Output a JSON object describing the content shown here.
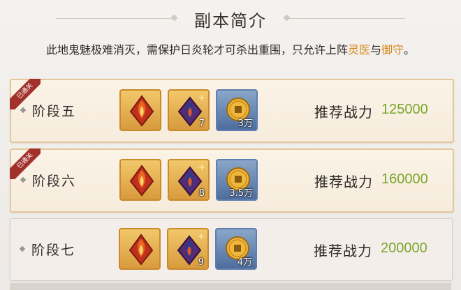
{
  "header": {
    "title": "副本简介",
    "description_prefix": "此地鬼魅极难消灭，需保护日炎轮才可杀出重围，只允许上阵",
    "highlight_1": "灵医",
    "connector": "与",
    "highlight_2": "御守",
    "description_suffix": "。"
  },
  "stages": [
    {
      "name": "阶段五",
      "cleared_label": "已通关",
      "rewards": [
        {
          "icon": "red-fire-fragment-icon",
          "qty": ""
        },
        {
          "icon": "purple-fire-fragment-icon",
          "qty": "7"
        },
        {
          "icon": "gold-coin-icon",
          "qty": "3万"
        }
      ],
      "power_label": "推荐战力",
      "power_value": "125000"
    },
    {
      "name": "阶段六",
      "cleared_label": "已通关",
      "rewards": [
        {
          "icon": "red-fire-fragment-icon",
          "qty": ""
        },
        {
          "icon": "purple-fire-fragment-icon",
          "qty": "8"
        },
        {
          "icon": "gold-coin-icon",
          "qty": "3.5万"
        }
      ],
      "power_label": "推荐战力",
      "power_value": "160000"
    },
    {
      "name": "阶段七",
      "rewards": [
        {
          "icon": "red-fire-fragment-icon",
          "qty": ""
        },
        {
          "icon": "purple-fire-fragment-icon",
          "qty": "9"
        },
        {
          "icon": "gold-coin-icon",
          "qty": "4万"
        }
      ],
      "power_label": "推荐战力",
      "power_value": "200000"
    }
  ],
  "colors": {
    "highlight": "#d78a1d",
    "power_value": "#7aa62b",
    "cleared_ribbon": "#a2312c"
  }
}
